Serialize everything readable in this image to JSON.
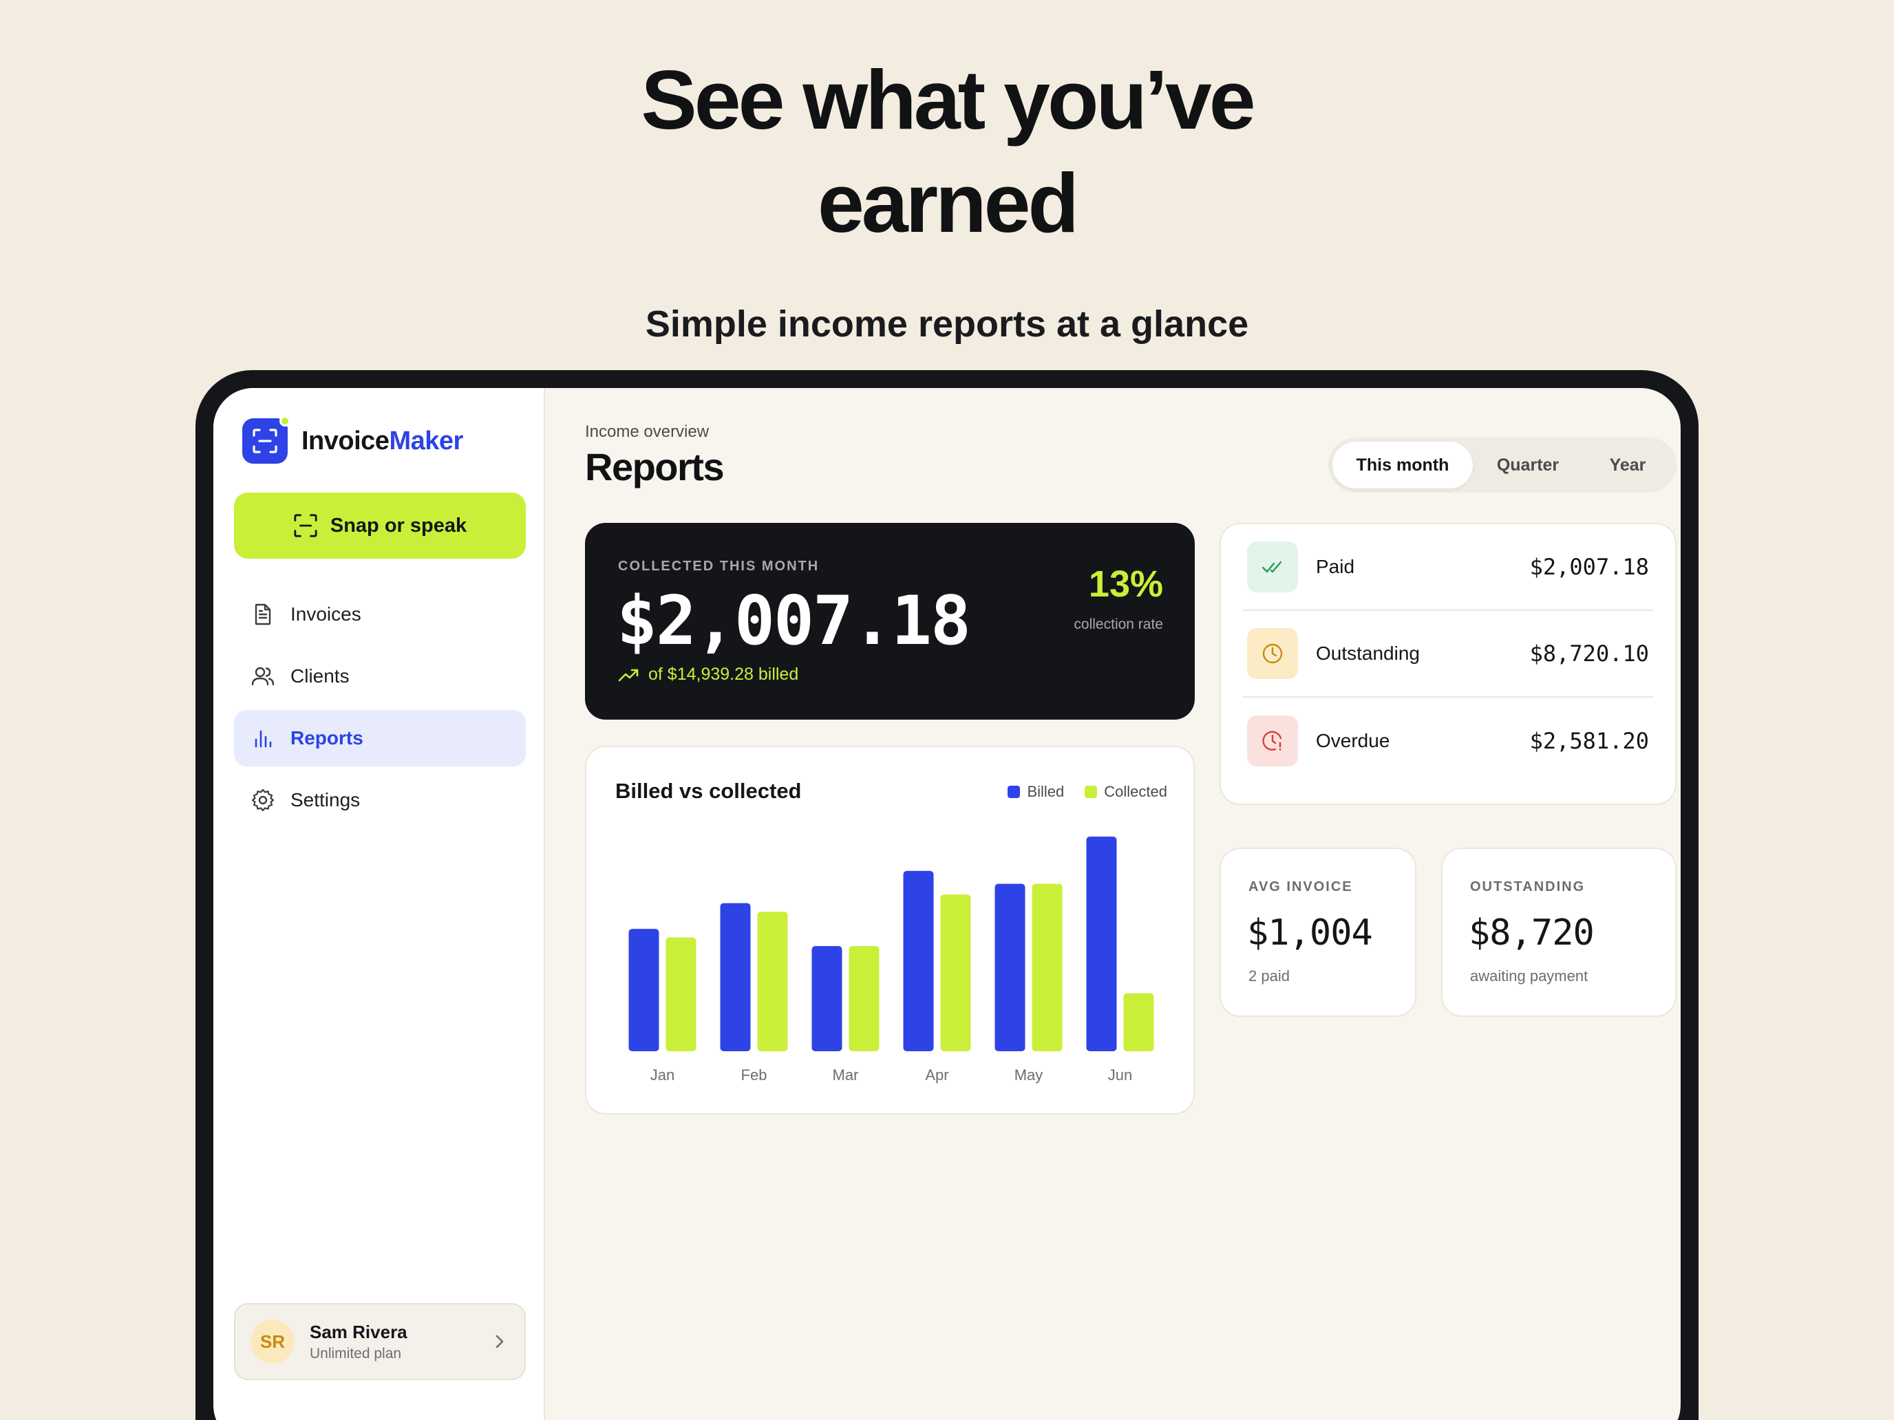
{
  "promo": {
    "headline_line1": "See what you’ve",
    "headline_line2": "earned",
    "subheadline": "Simple income reports at a glance"
  },
  "sidebar": {
    "brand_part1": "Invoice",
    "brand_part2": "Maker",
    "primary_action": "Snap or speak",
    "items": [
      {
        "label": "Invoices",
        "icon": "document-icon",
        "active": false
      },
      {
        "label": "Clients",
        "icon": "users-icon",
        "active": false
      },
      {
        "label": "Reports",
        "icon": "bar-chart-icon",
        "active": true
      },
      {
        "label": "Settings",
        "icon": "gear-icon",
        "active": false
      }
    ],
    "user": {
      "initials": "SR",
      "name": "Sam Rivera",
      "plan": "Unlimited plan"
    }
  },
  "header": {
    "overline": "Income overview",
    "title": "Reports",
    "periods": [
      "This month",
      "Quarter",
      "Year"
    ],
    "selected_period": "This month"
  },
  "hero": {
    "label": "COLLECTED THIS MONTH",
    "amount": "$2,007.18",
    "billed_text": "of $14,939.28 billed",
    "rate": "13%",
    "rate_label": "collection rate"
  },
  "status": [
    {
      "label": "Paid",
      "value": "$2,007.18",
      "icon": "double-check-icon"
    },
    {
      "label": "Outstanding",
      "value": "$8,720.10",
      "icon": "clock-icon"
    },
    {
      "label": "Overdue",
      "value": "$2,581.20",
      "icon": "alarm-clock-icon"
    }
  ],
  "metrics": [
    {
      "label": "AVG INVOICE",
      "value": "$1,004",
      "sub": "2 paid"
    },
    {
      "label": "OUTSTANDING",
      "value": "$8,720",
      "sub": "awaiting payment"
    }
  ],
  "colors": {
    "accent": "#2d43e6",
    "lime": "#c9ef38",
    "dark": "#141519",
    "paid_bg": "#e3f4ea",
    "outstanding_bg": "#fbecc6",
    "overdue_bg": "#fbe1de"
  },
  "chart_data": {
    "type": "bar",
    "title": "Billed vs collected",
    "categories": [
      "Jan",
      "Feb",
      "Mar",
      "Apr",
      "May",
      "Jun"
    ],
    "series": [
      {
        "name": "Billed",
        "color": "#2d43e6",
        "values": [
          57,
          69,
          49,
          84,
          78,
          100
        ]
      },
      {
        "name": "Collected",
        "color": "#c9ef38",
        "values": [
          53,
          65,
          49,
          73,
          78,
          27
        ]
      }
    ],
    "ylim": [
      0,
      100
    ],
    "grid": false,
    "legend": "top-right"
  }
}
